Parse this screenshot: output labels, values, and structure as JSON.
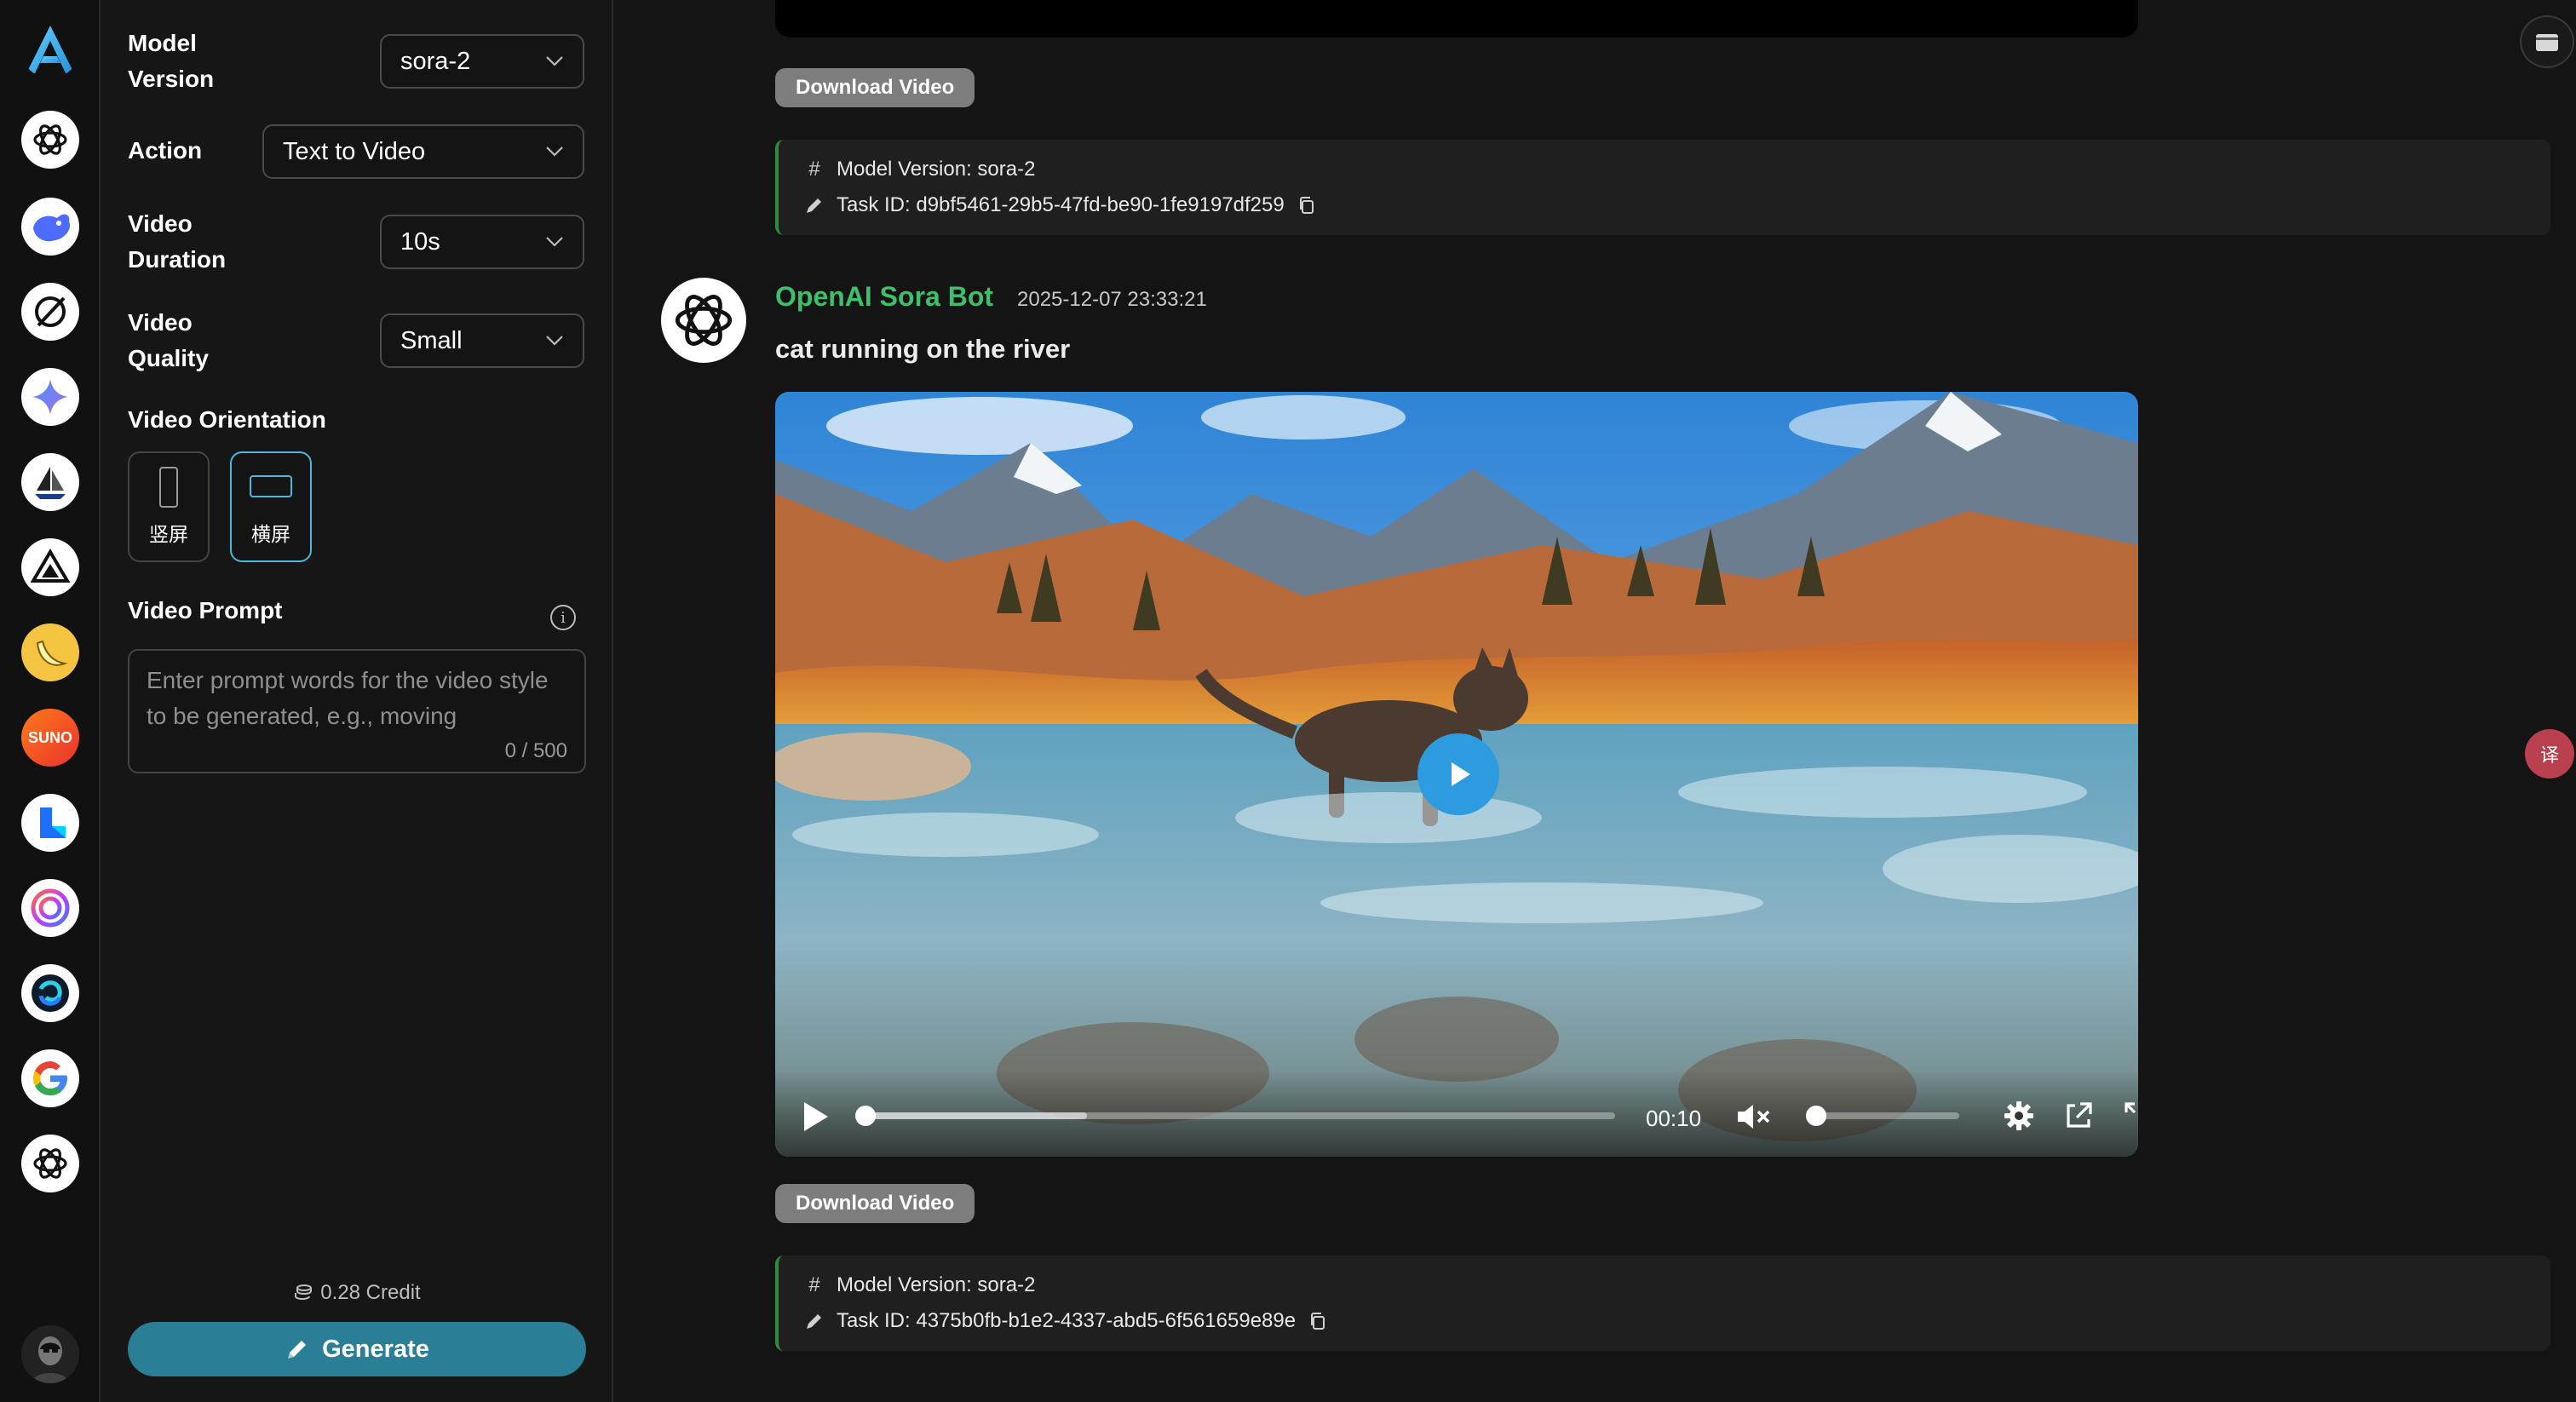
{
  "rail": {
    "items": [
      {
        "name": "app-logo-icon"
      },
      {
        "name": "openai-icon"
      },
      {
        "name": "deepseek-icon"
      },
      {
        "name": "midjourney-icon"
      },
      {
        "name": "gemini-icon"
      },
      {
        "name": "sailboat-icon"
      },
      {
        "name": "triangle-logo-icon"
      },
      {
        "name": "banana-icon"
      },
      {
        "name": "suno-icon",
        "text": "SUNO"
      },
      {
        "name": "kling-icon"
      },
      {
        "name": "spiral-icon"
      },
      {
        "name": "hailuo-icon"
      },
      {
        "name": "google-icon"
      },
      {
        "name": "openai-sora-icon"
      }
    ],
    "user_avatar": "user-avatar"
  },
  "settings": {
    "model_version": {
      "label_line1": "Model",
      "label_line2": "Version",
      "value": "sora-2"
    },
    "action": {
      "label": "Action",
      "value": "Text to Video"
    },
    "duration": {
      "label_line1": "Video",
      "label_line2": "Duration",
      "value": "10s"
    },
    "quality": {
      "label_line1": "Video",
      "label_line2": "Quality",
      "value": "Small"
    },
    "orientation": {
      "label": "Video Orientation",
      "portrait": "竖屏",
      "landscape": "横屏",
      "selected": "landscape"
    },
    "prompt": {
      "label": "Video Prompt",
      "placeholder": "Enter prompt words for the video style to be generated, e.g., moving",
      "counter": "0 / 500"
    },
    "credit": "0.28 Credit",
    "generate_label": "Generate"
  },
  "chat": {
    "download_label": "Download Video",
    "first_info": {
      "model_version": "Model Version: sora-2",
      "task_id": "Task ID: d9bf5461-29b5-47fd-be90-1fe9197df259"
    },
    "bot_name": "OpenAI Sora Bot",
    "timestamp": "2025-12-07 23:33:21",
    "message": "cat running on the river",
    "video": {
      "time": "00:10",
      "progress": 0.0,
      "volume": 0.0
    },
    "second_info": {
      "model_version": "Model Version: sora-2",
      "task_id": "Task ID: 4375b0fb-b1e2-4337-abd5-6f561659e89e"
    }
  },
  "colors": {
    "accent": "#2a7e96",
    "bot_name": "#3fbf6a",
    "play_button": "#2c9be0",
    "translate_badge": "#b8404f"
  }
}
